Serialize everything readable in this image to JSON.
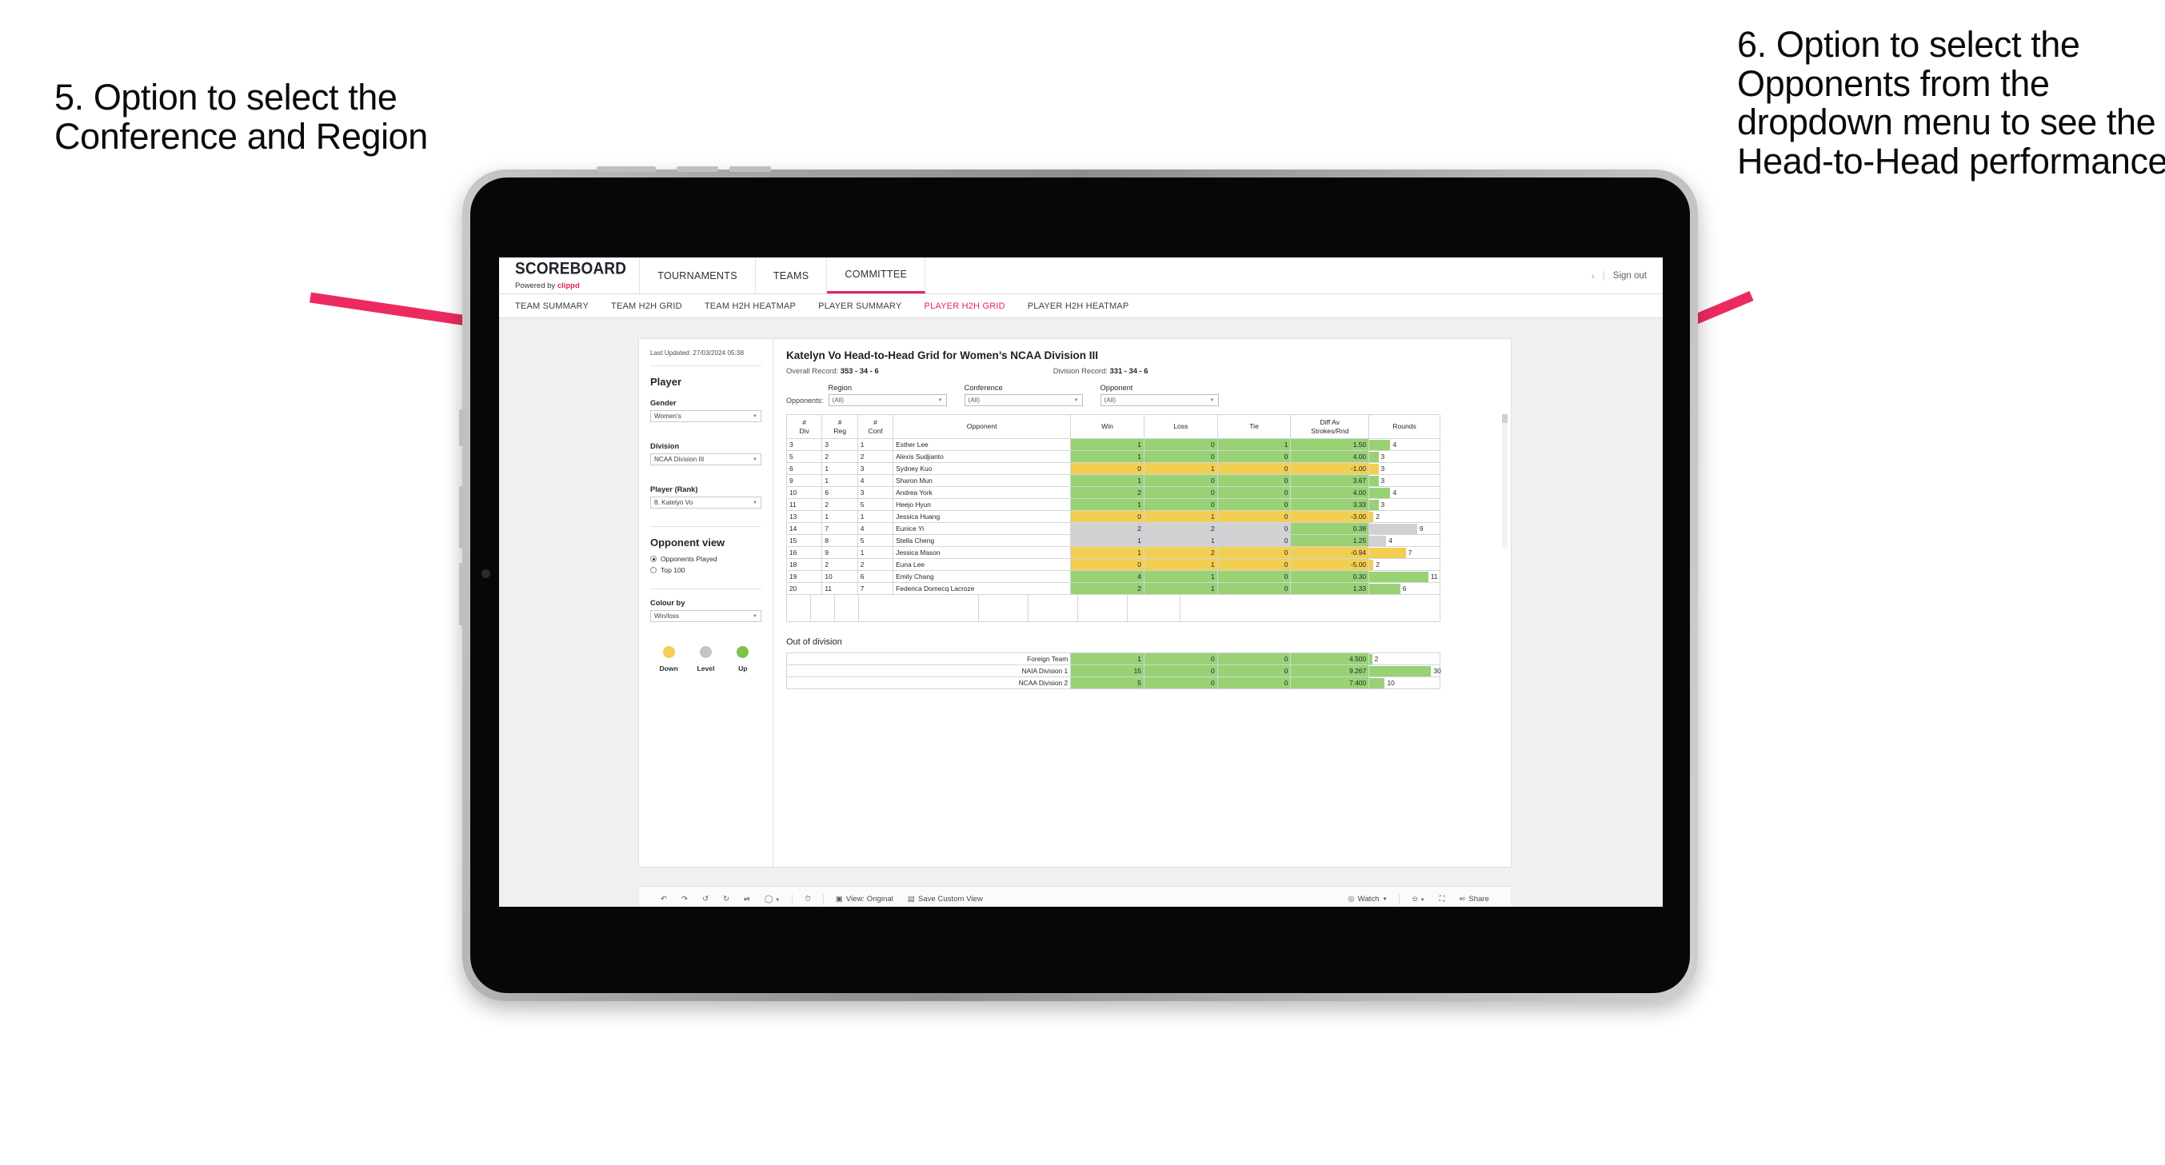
{
  "annotations": {
    "left": "5. Option to select the Conference and Region",
    "right": "6. Option to select the Opponents from the dropdown menu to see the Head-to-Head performance",
    "arrow_color": "#ec2a60"
  },
  "topnav": {
    "brand": "SCOREBOARD",
    "brand_sub_prefix": "Powered by ",
    "brand_sub_mark": "clippd",
    "items": [
      {
        "label": "TOURNAMENTS",
        "active": false
      },
      {
        "label": "TEAMS",
        "active": false
      },
      {
        "label": "COMMITTEE",
        "active": true
      }
    ],
    "chevron": "›",
    "divider": "|",
    "signout": "Sign out"
  },
  "subnav": {
    "items": [
      {
        "label": "TEAM SUMMARY",
        "active": false
      },
      {
        "label": "TEAM H2H GRID",
        "active": false
      },
      {
        "label": "TEAM H2H HEATMAP",
        "active": false
      },
      {
        "label": "PLAYER SUMMARY",
        "active": false
      },
      {
        "label": "PLAYER H2H GRID",
        "active": true
      },
      {
        "label": "PLAYER H2H HEATMAP",
        "active": false
      }
    ]
  },
  "sidebar": {
    "last_updated": "Last Updated: 27/03/2024 05:38",
    "player_heading": "Player",
    "gender_label": "Gender",
    "gender_value": "Women’s",
    "division_label": "Division",
    "division_value": "NCAA Division III",
    "player_rank_label": "Player (Rank)",
    "player_rank_value": "8. Katelyn Vo",
    "opponent_view_heading": "Opponent view",
    "opponent_view_options": [
      {
        "label": "Opponents Played",
        "selected": true
      },
      {
        "label": "Top 100",
        "selected": false
      }
    ],
    "colour_by_label": "Colour by",
    "colour_by_value": "Win/loss",
    "legend": [
      {
        "label": "Down",
        "color": "#f2cf52"
      },
      {
        "label": "Level",
        "color": "#c2c5c8"
      },
      {
        "label": "Up",
        "color": "#7cc24f"
      }
    ]
  },
  "main": {
    "title": "Katelyn Vo Head-to-Head Grid for Women’s NCAA Division III",
    "overall_record_label": "Overall Record: ",
    "overall_record_value": "353 -  34 - 6",
    "division_record_label": "Division Record: ",
    "division_record_value": "331 -  34 - 6",
    "opponents_label": "Opponents:",
    "filters": [
      {
        "label": "Region",
        "value": "(All)"
      },
      {
        "label": "Conference",
        "value": "(All)"
      },
      {
        "label": "Opponent",
        "value": "(All)"
      }
    ],
    "out_of_division_title": "Out of division"
  },
  "chart_data": {
    "type": "table",
    "title": "Katelyn Vo Head-to-Head Grid for Women’s NCAA Division III",
    "columns": [
      "# Div",
      "# Reg",
      "# Conf",
      "Opponent",
      "Win",
      "Loss",
      "Tie",
      "Diff Av Strokes/Rnd",
      "Rounds"
    ],
    "column_header_lines": [
      [
        "#",
        "Div"
      ],
      [
        "#",
        "Reg"
      ],
      [
        "#",
        "Conf"
      ],
      [
        "Opponent"
      ],
      [
        "Win"
      ],
      [
        "Loss"
      ],
      [
        "Tie"
      ],
      [
        "Diff Av",
        "Strokes/Rnd"
      ],
      [
        "Rounds"
      ]
    ],
    "rows": [
      {
        "div": "3",
        "reg": "3",
        "conf": "1",
        "opponent": "Esther Lee",
        "win": "1",
        "loss": "0",
        "tie": "1",
        "diff": "1.50",
        "rounds": "4",
        "rounds_pct": 30,
        "color": "up"
      },
      {
        "div": "5",
        "reg": "2",
        "conf": "2",
        "opponent": "Alexis Sudjianto",
        "win": "1",
        "loss": "0",
        "tie": "0",
        "diff": "4.00",
        "rounds": "3",
        "rounds_pct": 13,
        "color": "up"
      },
      {
        "div": "6",
        "reg": "1",
        "conf": "3",
        "opponent": "Sydney Kuo",
        "win": "0",
        "loss": "1",
        "tie": "0",
        "diff": "-1.00",
        "rounds": "3",
        "rounds_pct": 13,
        "color": "down"
      },
      {
        "div": "9",
        "reg": "1",
        "conf": "4",
        "opponent": "Sharon Mun",
        "win": "1",
        "loss": "0",
        "tie": "0",
        "diff": "3.67",
        "rounds": "3",
        "rounds_pct": 13,
        "color": "up"
      },
      {
        "div": "10",
        "reg": "6",
        "conf": "3",
        "opponent": "Andrea York",
        "win": "2",
        "loss": "0",
        "tie": "0",
        "diff": "4.00",
        "rounds": "4",
        "rounds_pct": 30,
        "color": "up"
      },
      {
        "div": "11",
        "reg": "2",
        "conf": "5",
        "opponent": "Heejo Hyun",
        "win": "1",
        "loss": "0",
        "tie": "0",
        "diff": "3.33",
        "rounds": "3",
        "rounds_pct": 13,
        "color": "up"
      },
      {
        "div": "13",
        "reg": "1",
        "conf": "1",
        "opponent": "Jessica Huang",
        "win": "0",
        "loss": "1",
        "tie": "0",
        "diff": "-3.00",
        "rounds": "2",
        "rounds_pct": 6,
        "color": "down"
      },
      {
        "div": "14",
        "reg": "7",
        "conf": "4",
        "opponent": "Eunice Yi",
        "win": "2",
        "loss": "2",
        "tie": "0",
        "diff": "0.38",
        "rounds": "9",
        "rounds_pct": 68,
        "color": "level"
      },
      {
        "div": "15",
        "reg": "8",
        "conf": "5",
        "opponent": "Stella Cheng",
        "win": "1",
        "loss": "1",
        "tie": "0",
        "diff": "1.25",
        "rounds": "4",
        "rounds_pct": 24,
        "color": "level"
      },
      {
        "div": "16",
        "reg": "9",
        "conf": "1",
        "opponent": "Jessica Mason",
        "win": "1",
        "loss": "2",
        "tie": "0",
        "diff": "-0.94",
        "rounds": "7",
        "rounds_pct": 52,
        "color": "down"
      },
      {
        "div": "18",
        "reg": "2",
        "conf": "2",
        "opponent": "Euna Lee",
        "win": "0",
        "loss": "1",
        "tie": "0",
        "diff": "-5.00",
        "rounds": "2",
        "rounds_pct": 6,
        "color": "down"
      },
      {
        "div": "19",
        "reg": "10",
        "conf": "6",
        "opponent": "Emily Chang",
        "win": "4",
        "loss": "1",
        "tie": "0",
        "diff": "0.30",
        "rounds": "11",
        "rounds_pct": 84,
        "color": "up"
      },
      {
        "div": "20",
        "reg": "11",
        "conf": "7",
        "opponent": "Federica Domecq Lacroze",
        "win": "2",
        "loss": "1",
        "tie": "0",
        "diff": "1.33",
        "rounds": "6",
        "rounds_pct": 44,
        "color": "up"
      }
    ],
    "out_of_division": [
      {
        "name": "Foreign Team",
        "win": "1",
        "loss": "0",
        "tie": "0",
        "diff": "4.500",
        "rounds": "2",
        "rounds_pct": 4,
        "color": "up"
      },
      {
        "name": "NAIA Division 1",
        "win": "15",
        "loss": "0",
        "tie": "0",
        "diff": "9.267",
        "rounds": "30",
        "rounds_pct": 88,
        "color": "up"
      },
      {
        "name": "NCAA Division 2",
        "win": "5",
        "loss": "0",
        "tie": "0",
        "diff": "7.400",
        "rounds": "10",
        "rounds_pct": 22,
        "color": "up"
      }
    ],
    "colors": {
      "up": "#98d275",
      "down": "#f2cf52",
      "level": "#cfd1d3"
    },
    "legend_position": "sidebar"
  },
  "toolbar": {
    "undo": "undo-icon",
    "redo": "redo-icon",
    "revert": "revert-icon",
    "refresh": "refresh-icon",
    "pause": "pause-icon",
    "view_original": "View: Original",
    "save_custom_view": "Save Custom View",
    "watch": "Watch",
    "share": "Share"
  }
}
